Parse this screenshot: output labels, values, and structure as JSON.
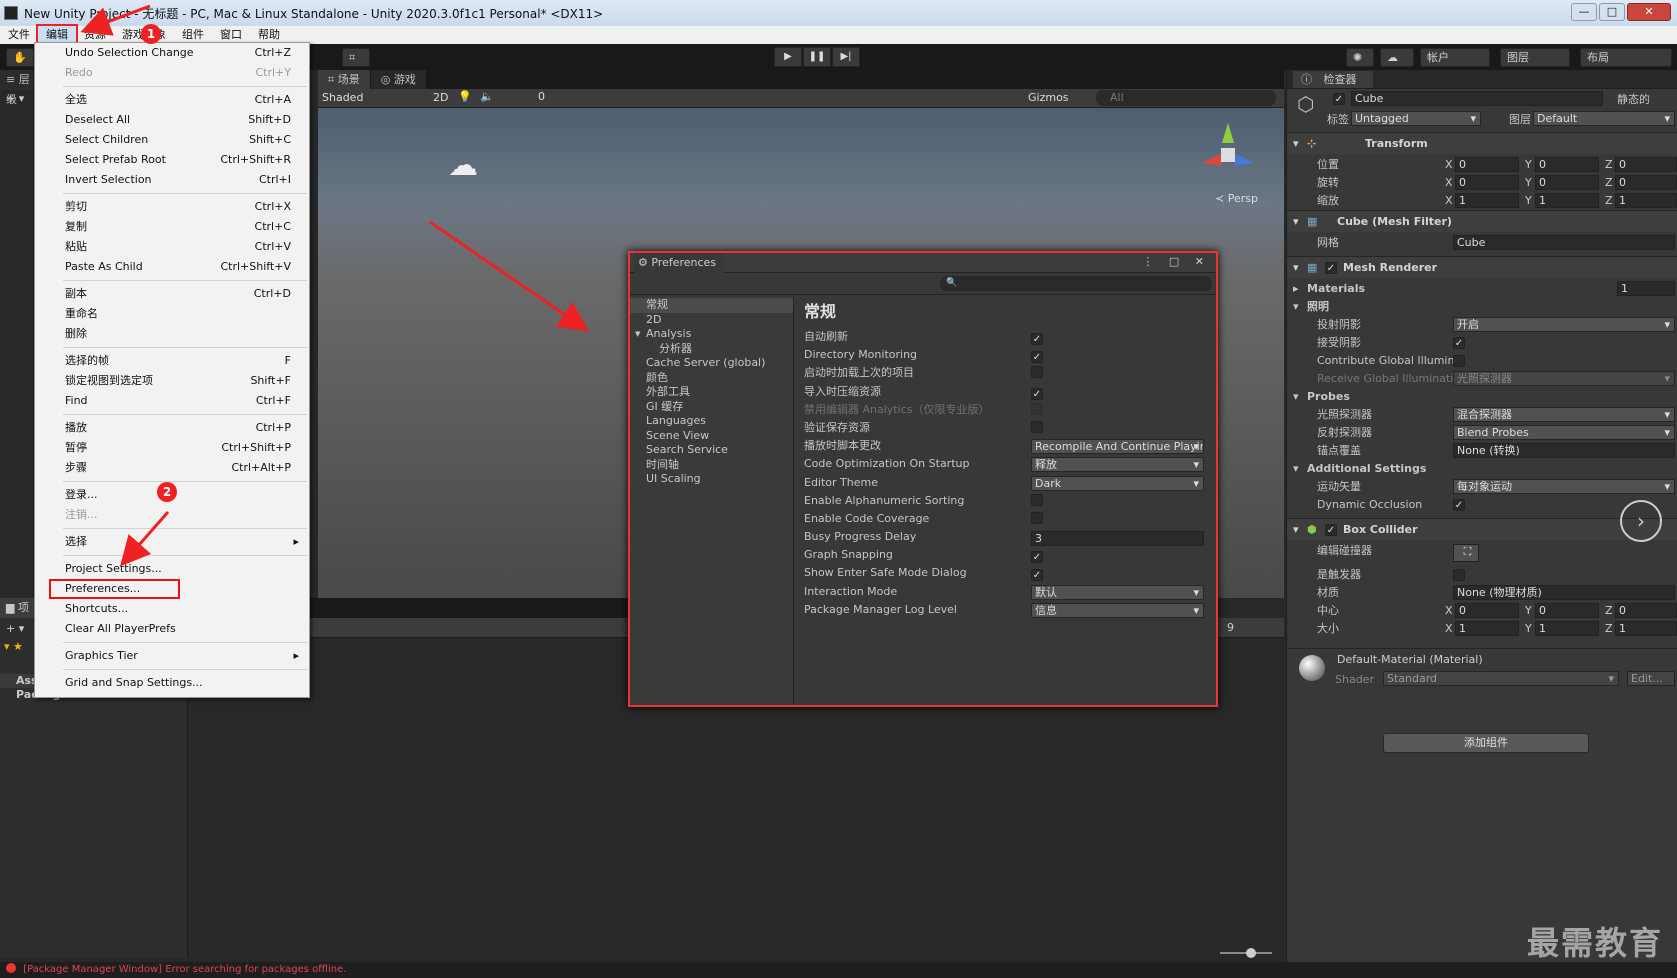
{
  "window": {
    "title": "New Unity Project - 无标题 - PC, Mac & Linux Standalone - Unity 2020.3.0f1c1 Personal* <DX11>",
    "controls": [
      "—",
      "□",
      "✕"
    ]
  },
  "menubar": [
    "文件",
    "编辑",
    "资源",
    "游戏对象",
    "组件",
    "窗口",
    "帮助"
  ],
  "toolbar": {
    "account": "帐户",
    "layers": "图层",
    "layout": "布局"
  },
  "hierarchy": {
    "tab": "层级"
  },
  "scene": {
    "tabs": [
      "场景",
      "游戏"
    ],
    "shading": "Shaded",
    "mode2d": "2D",
    "gizmos": "Gizmos",
    "search_placeholder": "All",
    "persp": "Persp",
    "count": "0"
  },
  "edit_menu": {
    "groups": [
      [
        {
          "label": "Undo Selection Change",
          "shortcut": "Ctrl+Z",
          "disabled": false
        },
        {
          "label": "Redo",
          "shortcut": "Ctrl+Y",
          "disabled": true
        }
      ],
      [
        {
          "label": "全选",
          "shortcut": "Ctrl+A"
        },
        {
          "label": "Deselect All",
          "shortcut": "Shift+D"
        },
        {
          "label": "Select Children",
          "shortcut": "Shift+C"
        },
        {
          "label": "Select Prefab Root",
          "shortcut": "Ctrl+Shift+R"
        },
        {
          "label": "Invert Selection",
          "shortcut": "Ctrl+I"
        }
      ],
      [
        {
          "label": "剪切",
          "shortcut": "Ctrl+X"
        },
        {
          "label": "复制",
          "shortcut": "Ctrl+C"
        },
        {
          "label": "粘贴",
          "shortcut": "Ctrl+V"
        },
        {
          "label": "Paste As Child",
          "shortcut": "Ctrl+Shift+V"
        }
      ],
      [
        {
          "label": "副本",
          "shortcut": "Ctrl+D"
        },
        {
          "label": "重命名",
          "shortcut": ""
        },
        {
          "label": "删除",
          "shortcut": ""
        }
      ],
      [
        {
          "label": "选择的帧",
          "shortcut": "F"
        },
        {
          "label": "锁定视图到选定项",
          "shortcut": "Shift+F"
        },
        {
          "label": "Find",
          "shortcut": "Ctrl+F"
        }
      ],
      [
        {
          "label": "播放",
          "shortcut": "Ctrl+P"
        },
        {
          "label": "暂停",
          "shortcut": "Ctrl+Shift+P"
        },
        {
          "label": "步骤",
          "shortcut": "Ctrl+Alt+P"
        }
      ],
      [
        {
          "label": "登录...",
          "shortcut": ""
        },
        {
          "label": "注销...",
          "shortcut": "",
          "disabled": true
        }
      ],
      [
        {
          "label": "选择",
          "shortcut": "",
          "submenu": true
        }
      ],
      [
        {
          "label": "Project Settings...",
          "shortcut": ""
        },
        {
          "label": "Preferences...",
          "shortcut": "",
          "highlighted": true
        },
        {
          "label": "Shortcuts...",
          "shortcut": ""
        },
        {
          "label": "Clear All PlayerPrefs",
          "shortcut": ""
        }
      ],
      [
        {
          "label": "Graphics Tier",
          "shortcut": "",
          "submenu": true
        }
      ],
      [
        {
          "label": "Grid and Snap Settings...",
          "shortcut": ""
        }
      ]
    ]
  },
  "preferences": {
    "title": "Preferences",
    "sidebar": [
      {
        "label": "常规",
        "selected": true
      },
      {
        "label": "2D"
      },
      {
        "label": "Analysis",
        "expanded": true
      },
      {
        "label": "分析器",
        "sub": true
      },
      {
        "label": "Cache Server (global)"
      },
      {
        "label": "颜色"
      },
      {
        "label": "外部工具"
      },
      {
        "label": "GI 缓存"
      },
      {
        "label": "Languages"
      },
      {
        "label": "Scene View"
      },
      {
        "label": "Search Service"
      },
      {
        "label": "时间轴"
      },
      {
        "label": "UI Scaling"
      }
    ],
    "heading": "常规",
    "settings": [
      {
        "label": "自动刷新",
        "type": "check",
        "value": true
      },
      {
        "label": "Directory Monitoring",
        "type": "check",
        "value": true
      },
      {
        "label": "启动时加载上次的项目",
        "type": "check",
        "value": false
      },
      {
        "label": "导入时压缩资源",
        "type": "check",
        "value": true
      },
      {
        "label": "禁用编辑器 Analytics（仅限专业版）",
        "type": "check",
        "value": false,
        "disabled": true
      },
      {
        "label": "验证保存资源",
        "type": "check",
        "value": false
      },
      {
        "label": "播放时脚本更改",
        "type": "dropdown",
        "value": "Recompile And Continue Playing"
      },
      {
        "label": "Code Optimization On Startup",
        "type": "dropdown",
        "value": "释放"
      },
      {
        "label": "Editor Theme",
        "type": "dropdown",
        "value": "Dark"
      },
      {
        "label": "Enable Alphanumeric Sorting",
        "type": "check",
        "value": false
      },
      {
        "label": "Enable Code Coverage",
        "type": "check",
        "value": false
      },
      {
        "label": "Busy Progress Delay",
        "type": "number",
        "value": "3"
      },
      {
        "label": "Graph Snapping",
        "type": "check",
        "value": true
      },
      {
        "label": "Show Enter Safe Mode Dialog",
        "type": "check",
        "value": true
      },
      {
        "label": "Interaction Mode",
        "type": "dropdown",
        "value": "默认"
      },
      {
        "label": "Package Manager Log Level",
        "type": "dropdown",
        "value": "信息"
      }
    ]
  },
  "project": {
    "tab": "项目",
    "folders": [
      "Assets",
      "Packages"
    ],
    "count": "9"
  },
  "inspector": {
    "tab": "检查器",
    "object_name": "Cube",
    "static_label": "静态的",
    "tag_label": "标签",
    "tag_value": "Untagged",
    "layer_label": "图层",
    "layer_value": "Default",
    "transform": {
      "title": "Transform",
      "rows": [
        {
          "label": "位置",
          "x": "0",
          "y": "0",
          "z": "0"
        },
        {
          "label": "旋转",
          "x": "0",
          "y": "0",
          "z": "0"
        },
        {
          "label": "缩放",
          "x": "1",
          "y": "1",
          "z": "1"
        }
      ]
    },
    "mesh_filter": {
      "title": "Cube (Mesh Filter)",
      "mesh_label": "网格",
      "mesh_value": "Cube"
    },
    "mesh_renderer": {
      "title": "Mesh Renderer",
      "materials_label": "Materials",
      "materials_count": "1",
      "lighting_label": "照明",
      "cast_shadows_label": "投射阴影",
      "cast_shadows_value": "开启",
      "receive_shadows_label": "接受阴影",
      "contribute_gi_label": "Contribute Global Illumin",
      "receive_gi_label": "Receive Global Illuminati",
      "receive_gi_value": "光照探测器",
      "probes_label": "Probes",
      "light_probes_label": "光照探测器",
      "light_probes_value": "混合探测器",
      "reflection_probes_label": "反射探测器",
      "reflection_probes_value": "Blend Probes",
      "anchor_label": "锚点覆盖",
      "anchor_value": "None (转换)",
      "additional_label": "Additional Settings",
      "motion_label": "运动矢量",
      "motion_value": "每对象运动",
      "dynamic_occlusion_label": "Dynamic Occlusion"
    },
    "box_collider": {
      "title": "Box Collider",
      "edit_label": "编辑碰撞器",
      "trigger_label": "是触发器",
      "material_label": "材质",
      "material_value": "None (物理材质)",
      "center_label": "中心",
      "center": {
        "x": "0",
        "y": "0",
        "z": "0"
      },
      "size_label": "大小",
      "size": {
        "x": "1",
        "y": "1",
        "z": "1"
      }
    },
    "material": {
      "title": "Default-Material (Material)",
      "shader_label": "Shader",
      "shader_value": "Standard",
      "edit_label": "Edit..."
    },
    "add_component": "添加组件"
  },
  "status": {
    "message": "[Package Manager Window] Error searching for packages offline."
  },
  "annotations": {
    "badge1": "1",
    "badge2": "2",
    "watermark": "最需教育"
  },
  "colors": {
    "annotation_red": "#e22222",
    "editor_bg": "#383838"
  }
}
